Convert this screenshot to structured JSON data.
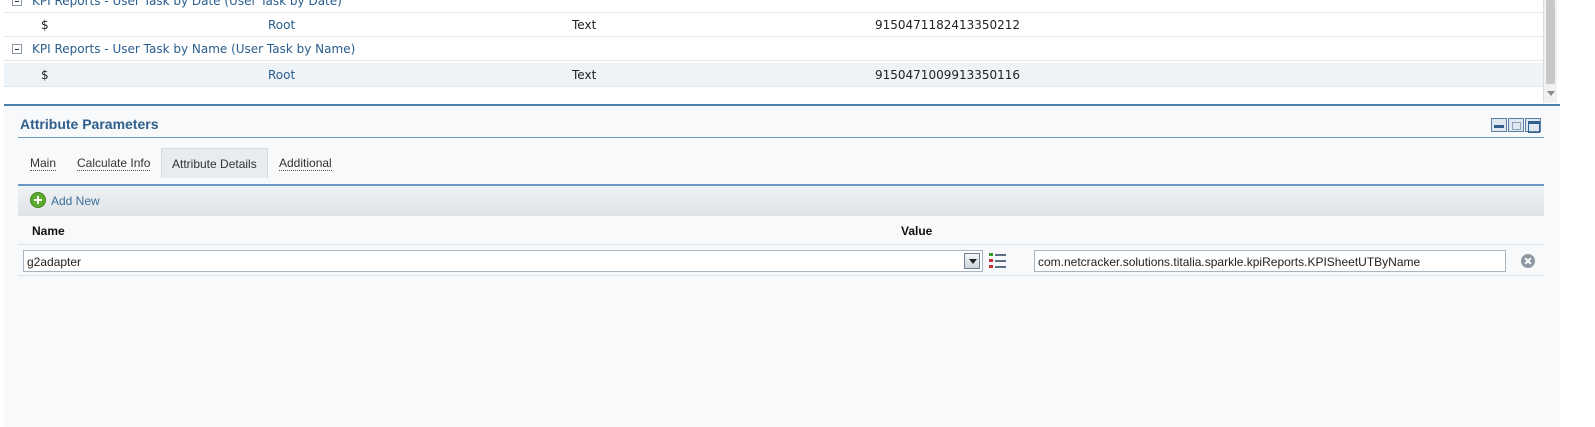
{
  "grid": {
    "groups": [
      {
        "label": "KPI Reports - User Task by Date (User Task by Date)"
      },
      {
        "label": "KPI Reports - User Task by Name (User Task by Name)"
      }
    ],
    "rows": [
      {
        "col1": "$",
        "col2": "Root",
        "col3": "Text",
        "col4": "9150471182413350212"
      },
      {
        "col1": "$",
        "col2": "Root",
        "col3": "Text",
        "col4": "9150471009913350116"
      }
    ]
  },
  "panel": {
    "title": "Attribute Parameters",
    "tabs": [
      {
        "label": "Main"
      },
      {
        "label": "Calculate Info"
      },
      {
        "label": "Attribute Details"
      },
      {
        "label": "Additional"
      }
    ],
    "active_tab": "Attribute Details",
    "add_new_label": "Add New",
    "columns": {
      "name": "Name",
      "value": "Value"
    },
    "attribute": {
      "name": "g2adapter",
      "value": "com.netcracker.solutions.titalia.sparkle.kpiReports.KPISheetUTByName"
    }
  },
  "colors": {
    "accent": "#2f5f8c",
    "link": "#2a5d8e",
    "add_icon": "#5aab2e"
  }
}
